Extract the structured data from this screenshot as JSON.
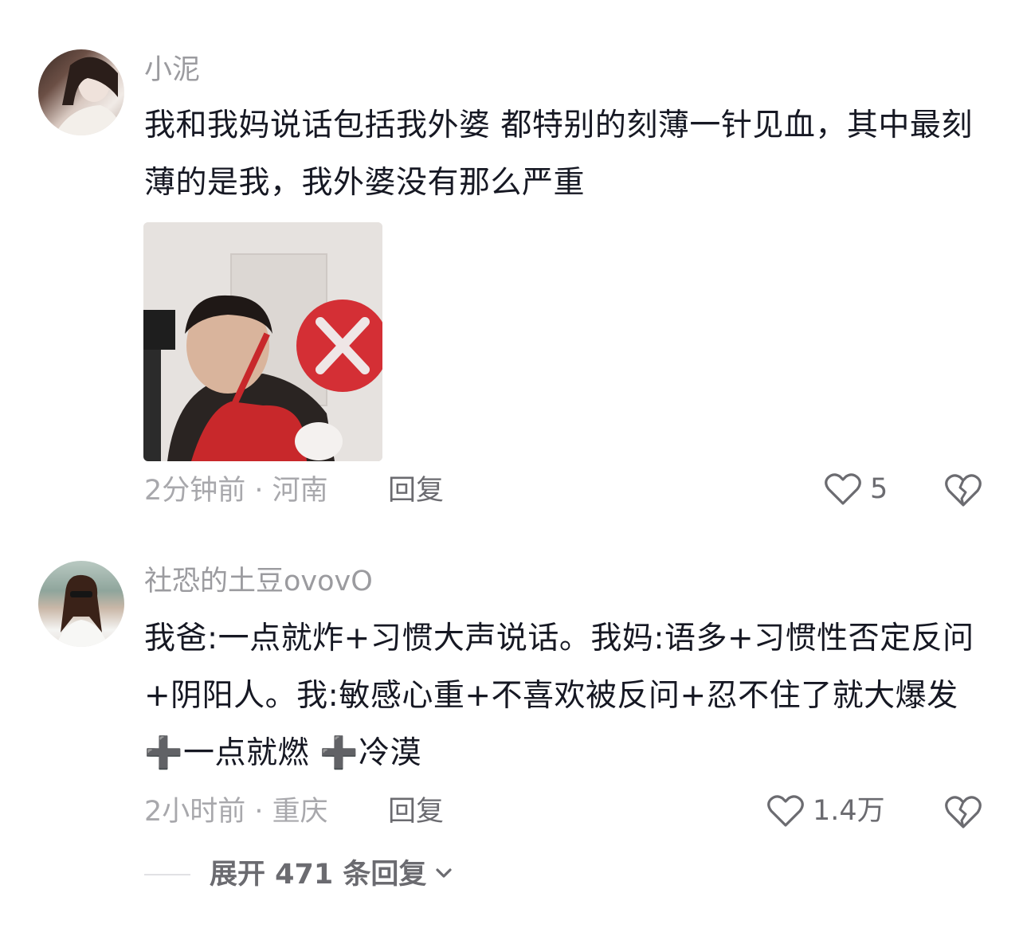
{
  "comments": [
    {
      "username": "小泥",
      "text": "我和我妈说话包括我外婆 都特别的刻薄一针见血，其中最刻薄的是我，我外婆没有那么严重",
      "meta": "2分钟前 · 河南",
      "reply_label": "回复",
      "like_count": "5",
      "has_image": true
    },
    {
      "username": "社恐的土豆ovovO",
      "text": "我爸:一点就炸+习惯大声说话。我妈:语多+习惯性否定反问+阴阳人。我:敏感心重+不喜欢被反问+忍不住了就大爆发 ➕一点就燃 ➕冷漠",
      "meta": "2小时前 · 重庆",
      "reply_label": "回复",
      "like_count": "1.4万",
      "has_image": false
    }
  ],
  "expand": {
    "label": "展开 471 条回复"
  },
  "icons": {
    "like": "heart-outline-icon",
    "dislike": "broken-heart-icon",
    "expand": "chevron-down-icon"
  },
  "colors": {
    "text_primary": "#161823",
    "text_secondary": "#9b9b9f",
    "action": "#6b6b70"
  }
}
